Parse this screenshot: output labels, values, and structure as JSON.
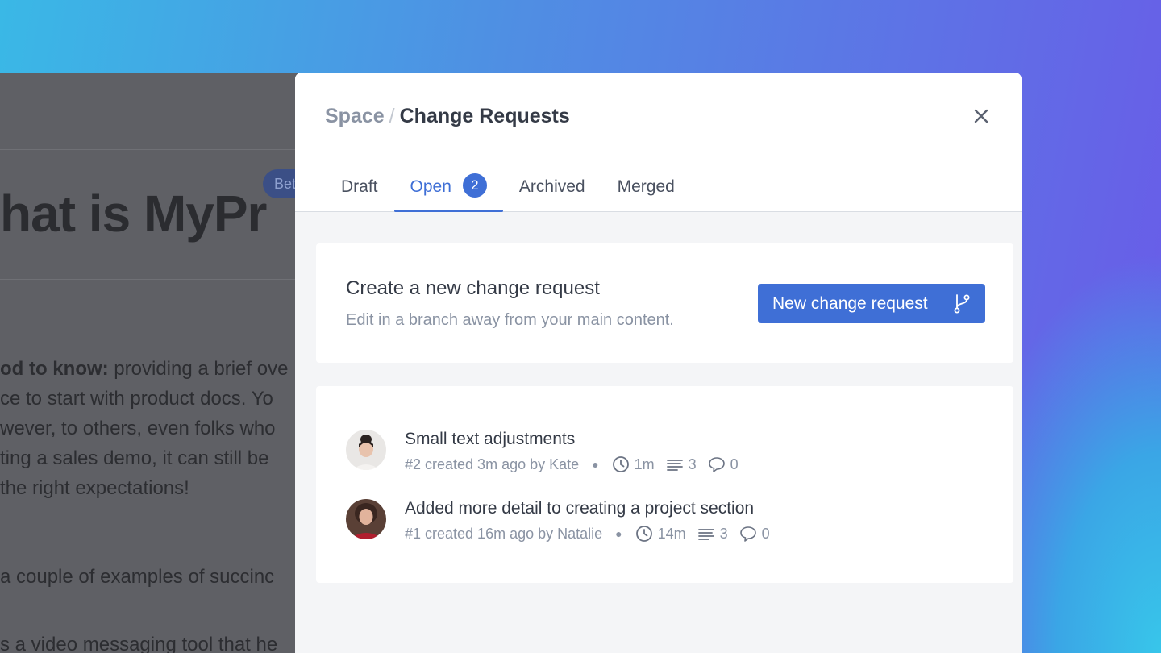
{
  "background_doc": {
    "pill_label": "Bet",
    "title": "hat is MyPr",
    "paragraph_lines": [
      {
        "bold": "od to know:",
        "text": " providing a brief ove"
      },
      {
        "bold": "",
        "text": "ce to start with product docs. Yo"
      },
      {
        "bold": "",
        "text": "wever, to others, even folks who"
      },
      {
        "bold": "",
        "text": "ting a sales demo, it can still be"
      },
      {
        "bold": "",
        "text": " the right expectations!"
      }
    ],
    "para2": "a couple of examples of succinc",
    "para3": "s a video messaging tool that he"
  },
  "modal": {
    "breadcrumb": {
      "space": "Space",
      "separator": "/",
      "current": "Change Requests"
    },
    "close_icon": "close-icon",
    "tabs": [
      {
        "label": "Draft",
        "active": false
      },
      {
        "label": "Open",
        "active": true,
        "badge": "2"
      },
      {
        "label": "Archived",
        "active": false
      },
      {
        "label": "Merged",
        "active": false
      }
    ],
    "create": {
      "title": "Create a new change request",
      "subtitle": "Edit in a branch away from your main content.",
      "button_label": "New change request",
      "button_icon": "git-branch-icon"
    },
    "change_requests": [
      {
        "title": "Small text adjustments",
        "meta": "#2 created 3m ago by Kate",
        "time": "1m",
        "changes": "3",
        "comments": "0"
      },
      {
        "title": "Added more detail to creating a project section",
        "meta": "#1 created 16m ago by Natalie",
        "time": "14m",
        "changes": "3",
        "comments": "0"
      }
    ]
  },
  "colors": {
    "accent": "#3f6fd6",
    "text": "#343a46",
    "muted": "#8a93a3"
  }
}
